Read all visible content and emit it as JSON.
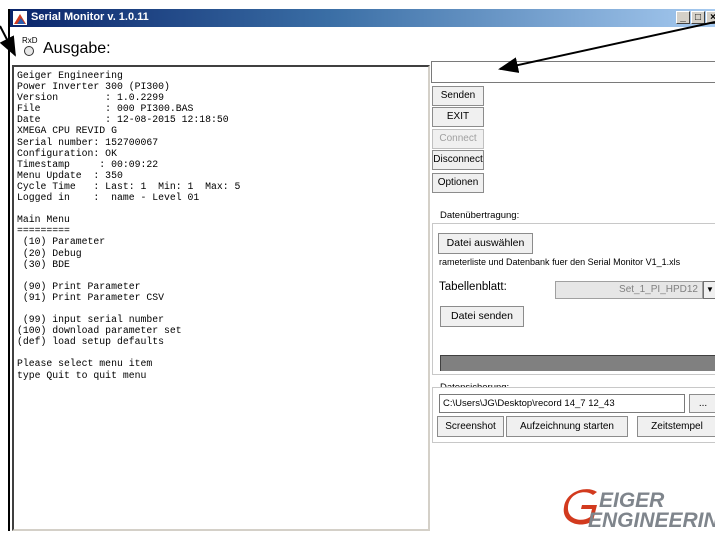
{
  "window": {
    "title": "Serial Monitor v. 1.0.11",
    "minimize": "_",
    "maximize": "□",
    "close": "×"
  },
  "output_header": {
    "rxd_label": "RxD",
    "title": "Ausgabe:"
  },
  "output_lines": [
    "Geiger Engineering",
    "Power Inverter 300 (PI300)",
    "Version        : 1.0.2299",
    "File           : 000 PI300.BAS",
    "Date           : 12-08-2015 12:18:50",
    "XMEGA CPU REVID G",
    "Serial number: 152700067",
    "Configuration: OK",
    "Timestamp     : 00:09:22",
    "Menu Update  : 350",
    "Cycle Time   : Last: 1  Min: 1  Max: 5",
    "Logged in    :  name - Level 01",
    "",
    "Main Menu",
    "=========",
    " (10) Parameter",
    " (20) Debug",
    " (30) BDE",
    "",
    " (90) Print Parameter",
    " (91) Print Parameter CSV",
    "",
    " (99) input serial number",
    "(100) download parameter set",
    "(def) load setup defaults",
    "",
    "Please select menu item",
    "type Quit to quit menu"
  ],
  "command": {
    "input_value": ""
  },
  "buttons": {
    "senden": "Senden",
    "exit": "EXIT",
    "connect": "Connect",
    "disconnect": "Disconnect",
    "optionen": "Optionen"
  },
  "datenuebertragung": {
    "label": "Datenübertragung:",
    "select_file": "Datei auswählen",
    "file_info": "rameterliste und Datenbank fuer den Serial Monitor V1_1.xls",
    "sheet_label": "Tabellenblatt:",
    "sheet_value": "Set_1_PI_HPD12",
    "send_file": "Datei senden",
    "progress": 1.0
  },
  "datensicherung": {
    "label": "Datensicherung:",
    "path": "C:\\Users\\JG\\Desktop\\record 14_7 12_43",
    "browse": "...",
    "screenshot": "Screenshot",
    "start_recording": "Aufzeichnung starten",
    "timestamp": "Zeitstempel"
  },
  "logo": {
    "line1": "EIGER",
    "line2": "ENGINEERING"
  },
  "colors": {
    "titlebar_start": "#0a246a",
    "titlebar_end": "#a6caf0",
    "logo_grey": "#7f858c",
    "logo_red": "#d23a1e"
  }
}
